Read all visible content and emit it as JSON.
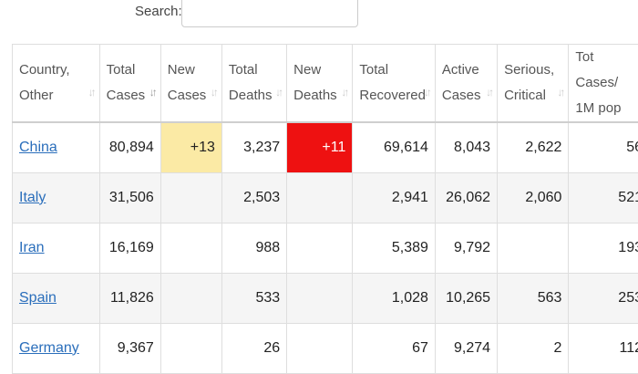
{
  "search": {
    "label": "Search:",
    "value": ""
  },
  "columns": [
    "Country, Other",
    "Total Cases",
    "New Cases",
    "Total Deaths",
    "New Deaths",
    "Total Recovered",
    "Active Cases",
    "Serious, Critical",
    "Tot Cases/ 1M pop"
  ],
  "rows": [
    {
      "country": "China",
      "total_cases": "80,894",
      "new_cases": "+13",
      "total_deaths": "3,237",
      "new_deaths": "+11",
      "total_recovered": "69,614",
      "active_cases": "8,043",
      "serious": "2,622",
      "per_million": "56"
    },
    {
      "country": "Italy",
      "total_cases": "31,506",
      "new_cases": "",
      "total_deaths": "2,503",
      "new_deaths": "",
      "total_recovered": "2,941",
      "active_cases": "26,062",
      "serious": "2,060",
      "per_million": "521"
    },
    {
      "country": "Iran",
      "total_cases": "16,169",
      "new_cases": "",
      "total_deaths": "988",
      "new_deaths": "",
      "total_recovered": "5,389",
      "active_cases": "9,792",
      "serious": "",
      "per_million": "193"
    },
    {
      "country": "Spain",
      "total_cases": "11,826",
      "new_cases": "",
      "total_deaths": "533",
      "new_deaths": "",
      "total_recovered": "1,028",
      "active_cases": "10,265",
      "serious": "563",
      "per_million": "253"
    },
    {
      "country": "Germany",
      "total_cases": "9,367",
      "new_cases": "",
      "total_deaths": "26",
      "new_deaths": "",
      "total_recovered": "67",
      "active_cases": "9,274",
      "serious": "2",
      "per_million": "112"
    }
  ],
  "colors": {
    "new_cases_highlight": "#fbeaa5",
    "new_deaths_highlight": "#ee1111",
    "link": "#2a6ebb"
  },
  "icons": {
    "sort": "sort-arrows-icon"
  }
}
